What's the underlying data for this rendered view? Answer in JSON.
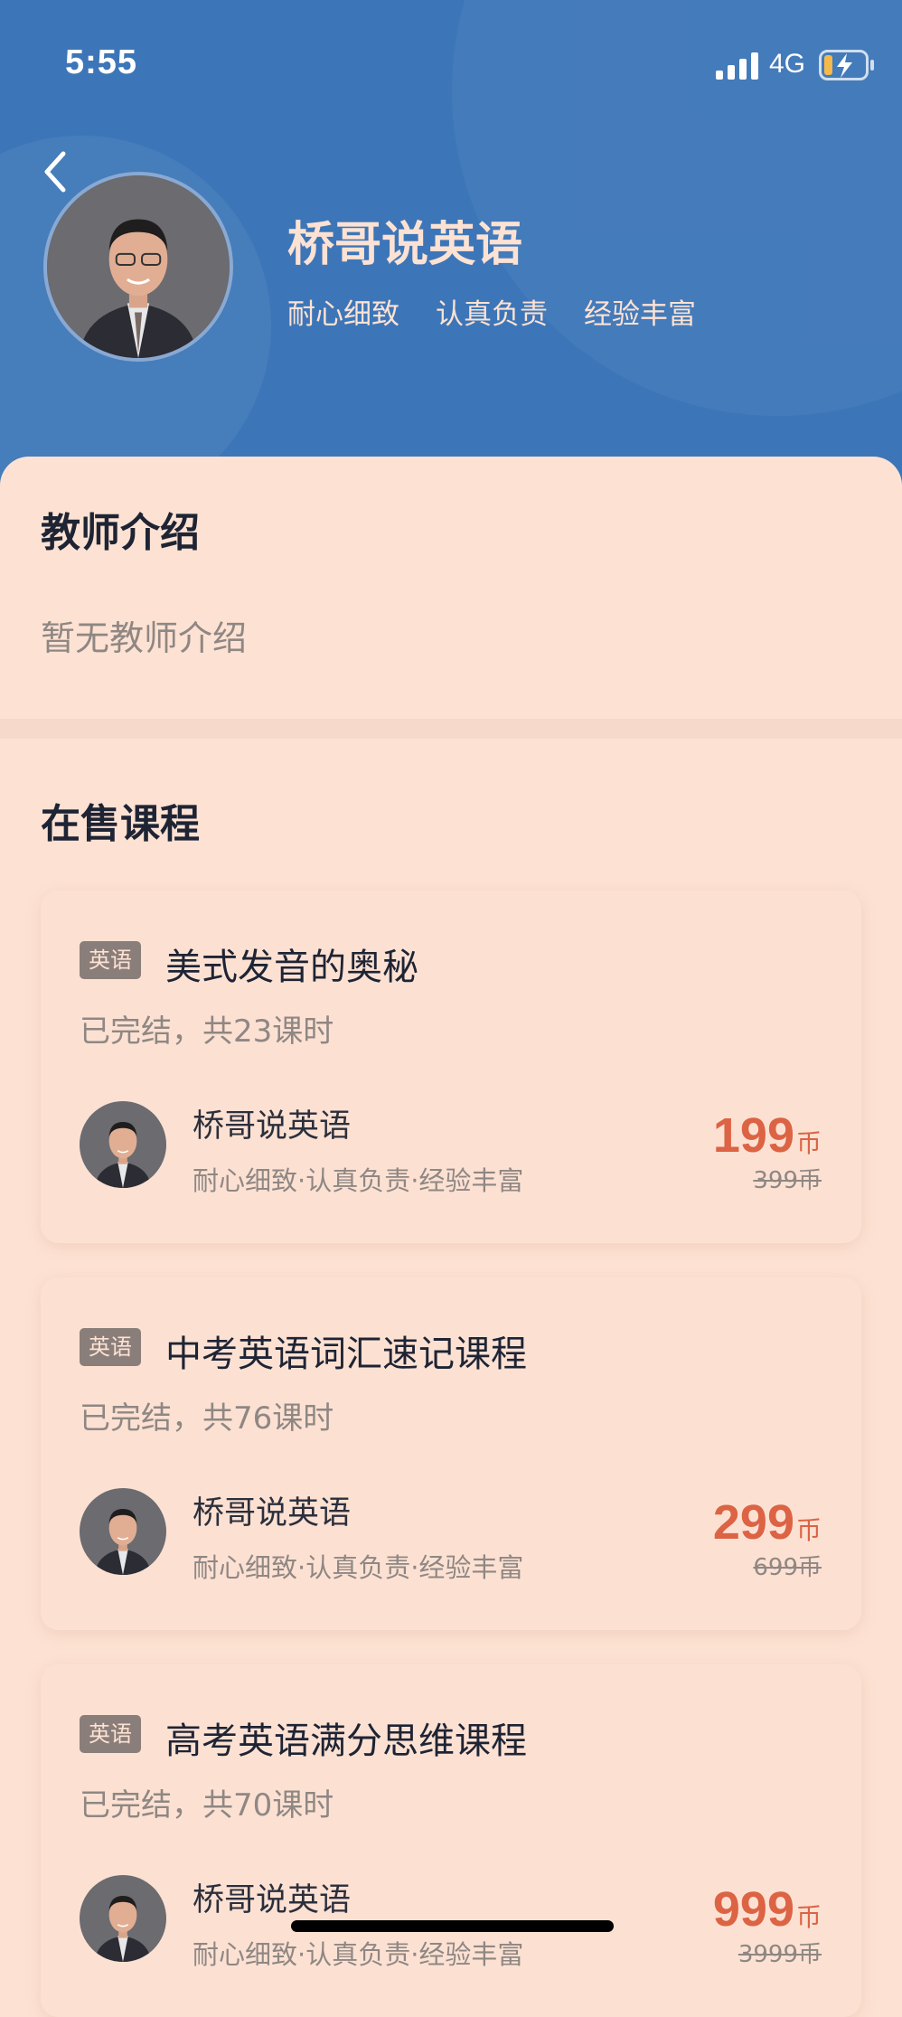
{
  "status_bar": {
    "time": "5:55",
    "network": "4G"
  },
  "teacher": {
    "name": "桥哥说英语",
    "tags": [
      "耐心细致",
      "认真负责",
      "经验丰富"
    ]
  },
  "intro": {
    "title": "教师介绍",
    "text": "暂无教师介绍"
  },
  "courses_section": {
    "title": "在售课程",
    "courses": [
      {
        "subject": "英语",
        "title": "美式发音的奥秘",
        "status": "已完结，共23课时",
        "teacher_name": "桥哥说英语",
        "teacher_tags": "耐心细致·认真负责·经验丰富",
        "price": "199",
        "unit": "币",
        "original_price": "399币"
      },
      {
        "subject": "英语",
        "title": "中考英语词汇速记课程",
        "status": "已完结，共76课时",
        "teacher_name": "桥哥说英语",
        "teacher_tags": "耐心细致·认真负责·经验丰富",
        "price": "299",
        "unit": "币",
        "original_price": "699币"
      },
      {
        "subject": "英语",
        "title": "高考英语满分思维课程",
        "status": "已完结，共70课时",
        "teacher_name": "桥哥说英语",
        "teacher_tags": "耐心细致·认真负责·经验丰富",
        "price": "999",
        "unit": "币",
        "original_price": "3999币"
      }
    ]
  },
  "colors": {
    "header": "#3d76b8",
    "background": "#fde2d3",
    "price": "#dc6344"
  }
}
